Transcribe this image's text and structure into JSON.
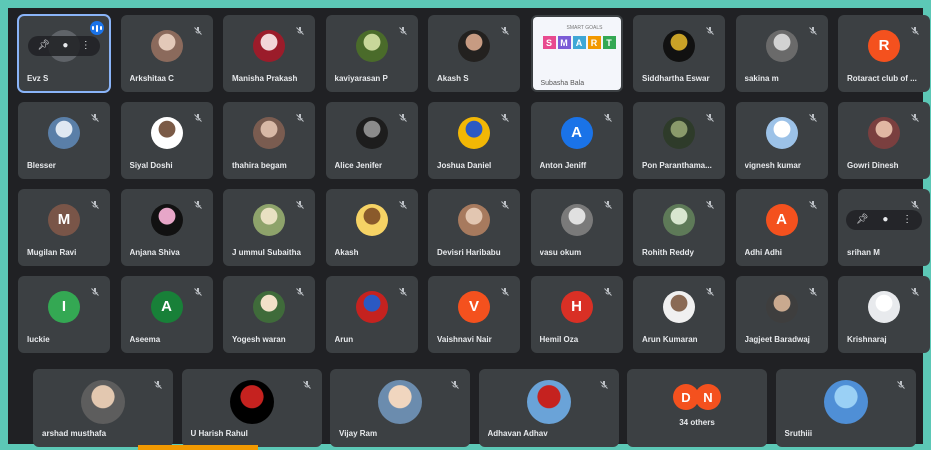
{
  "colors": {
    "tile_bg": "#3c4043",
    "stage_bg": "#202124",
    "active_outline": "#8ab4f8",
    "page_border": "#5cc8b6"
  },
  "rows": [
    [
      {
        "name": "Evz S",
        "type": "self",
        "active": true
      },
      {
        "name": "Arkshitaa C",
        "type": "photo",
        "tone": [
          "#8b6a5c",
          "#e3c9b9"
        ]
      },
      {
        "name": "Manisha Prakash",
        "type": "photo",
        "tone": [
          "#9b1c2a",
          "#f2d6d8"
        ]
      },
      {
        "name": "kaviyarasan P",
        "type": "photo",
        "tone": [
          "#4a6b2a",
          "#c8d79a"
        ]
      },
      {
        "name": "Akash S",
        "type": "photo",
        "tone": [
          "#23211f",
          "#c79b82"
        ]
      },
      {
        "name": "Subasha Bala",
        "type": "presentation",
        "slide_header": "SMART GOALS",
        "slide_letters": [
          "S",
          "M",
          "A",
          "R",
          "T"
        ]
      },
      {
        "name": "Siddhartha Eswar",
        "type": "photo",
        "tone": [
          "#111111",
          "#c9a227"
        ]
      },
      {
        "name": "sakina m",
        "type": "photo",
        "tone": [
          "#6a6a6a",
          "#d2d2d2"
        ]
      },
      {
        "name": "Rotaract club of ...",
        "type": "initial",
        "initial": "R",
        "color": "#f4511e"
      }
    ],
    [
      {
        "name": "Blesser",
        "type": "photo",
        "tone": [
          "#5a7fa8",
          "#dfe8f2"
        ]
      },
      {
        "name": "Siyal Doshi",
        "type": "photo",
        "tone": [
          "#ffffff",
          "#7a5a46"
        ]
      },
      {
        "name": "thahira begam",
        "type": "photo",
        "tone": [
          "#7a5c50",
          "#d8b8a6"
        ]
      },
      {
        "name": "Alice Jenifer",
        "type": "photo",
        "tone": [
          "#1d1d1d",
          "#8b8b8b"
        ]
      },
      {
        "name": "Joshua Daniel",
        "type": "photo",
        "tone": [
          "#f2b705",
          "#2b59c3"
        ]
      },
      {
        "name": "Anton Jeniff",
        "type": "initial",
        "initial": "A",
        "color": "#1a73e8"
      },
      {
        "name": "Pon Paranthama...",
        "type": "photo",
        "tone": [
          "#2e3b2a",
          "#8a9a6b"
        ]
      },
      {
        "name": "vignesh kumar",
        "type": "photo",
        "tone": [
          "#9cc2e8",
          "#ffffff"
        ]
      },
      {
        "name": "Gowri Dinesh",
        "type": "photo",
        "tone": [
          "#7a3f3f",
          "#e1b7a3"
        ]
      }
    ],
    [
      {
        "name": "Mugilan Ravi",
        "type": "initial",
        "initial": "M",
        "color": "#795548"
      },
      {
        "name": "Anjana Shiva",
        "type": "photo",
        "tone": [
          "#111111",
          "#e7a6c8"
        ]
      },
      {
        "name": "J ummul Subaitha",
        "type": "photo",
        "tone": [
          "#8ea36b",
          "#e9e1c2"
        ]
      },
      {
        "name": "Akash",
        "type": "photo",
        "tone": [
          "#f6d365",
          "#8a5a2b"
        ]
      },
      {
        "name": "Devisri Haribabu",
        "type": "photo",
        "tone": [
          "#a77a5e",
          "#e2c6b1"
        ]
      },
      {
        "name": "vasu okum",
        "type": "photo",
        "tone": [
          "#7a7a7a",
          "#e0e0e0"
        ]
      },
      {
        "name": "Rohith Reddy",
        "type": "photo",
        "tone": [
          "#5e7a58",
          "#d8e6cf"
        ]
      },
      {
        "name": "Adhi Adhi",
        "type": "initial",
        "initial": "A",
        "color": "#f4511e"
      },
      {
        "name": "srihan M",
        "type": "hover"
      }
    ],
    [
      {
        "name": "luckie",
        "type": "initial",
        "initial": "I",
        "color": "#34a853"
      },
      {
        "name": "Aseema",
        "type": "initial",
        "initial": "A",
        "color": "#188038"
      },
      {
        "name": "Yogesh waran",
        "type": "photo",
        "tone": [
          "#3f6b3a",
          "#f2e1c8"
        ]
      },
      {
        "name": "Arun",
        "type": "photo",
        "tone": [
          "#c5221f",
          "#2b59c3"
        ]
      },
      {
        "name": "Vaishnavi Nair",
        "type": "initial",
        "initial": "V",
        "color": "#f4511e"
      },
      {
        "name": "Hemil Oza",
        "type": "initial",
        "initial": "H",
        "color": "#d93025"
      },
      {
        "name": "Arun Kumaran",
        "type": "photo",
        "tone": [
          "#f0f0f0",
          "#8a6a54"
        ]
      },
      {
        "name": "Jagjeet Baradwaj",
        "type": "photo",
        "tone": [
          "#3e3e3e",
          "#c9a98f"
        ]
      },
      {
        "name": "Krishnaraj",
        "type": "photo",
        "tone": [
          "#e8eaed",
          "#ffffff"
        ]
      }
    ],
    [
      {
        "name": "arshad musthafa",
        "type": "photo",
        "tone": [
          "#5d5d5d",
          "#e3c8b0"
        ]
      },
      {
        "name": "U Harish Rahul",
        "type": "photo",
        "tone": [
          "#000000",
          "#c5221f"
        ]
      },
      {
        "name": "Vijay Ram",
        "type": "photo",
        "tone": [
          "#6b8cae",
          "#f0d6bf"
        ]
      },
      {
        "name": "Adhavan Adhav",
        "type": "photo",
        "tone": [
          "#6aa3d8",
          "#c5221f"
        ]
      },
      {
        "name": "34 others",
        "type": "others",
        "initials": [
          "D",
          "N"
        ],
        "color": "#f4511e"
      },
      {
        "name": "Sruthiii",
        "type": "photo",
        "tone": [
          "#4f8fd6",
          "#9ad0f5"
        ]
      }
    ]
  ]
}
